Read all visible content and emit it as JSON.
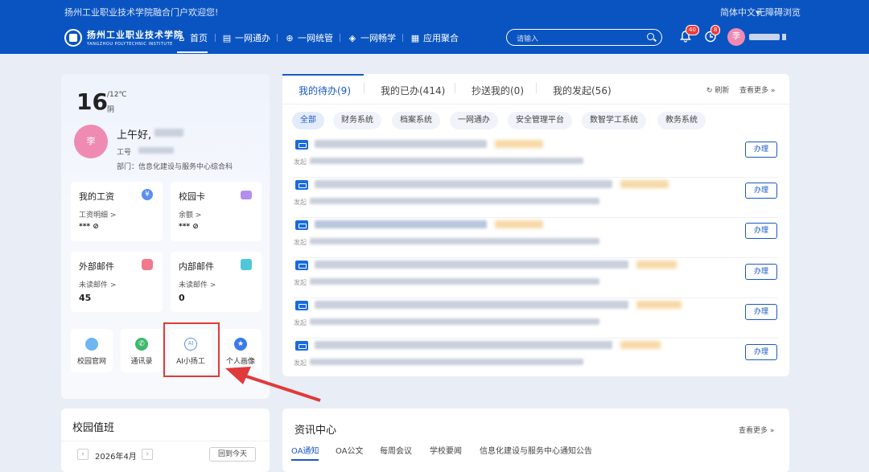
{
  "header": {
    "welcome": "扬州工业职业技术学院融合门户欢迎您!",
    "lang": "简体中文",
    "accessibility": "无障碍浏览",
    "logo_cn": "扬州工业职业技术学院",
    "logo_en": "YANGZHOU POLYTECHNIC INSTITUTE"
  },
  "nav": {
    "items": [
      {
        "label": "首页",
        "icon": "home-icon"
      },
      {
        "label": "一网通办",
        "icon": "briefcase-icon"
      },
      {
        "label": "一网统管",
        "icon": "globe-icon"
      },
      {
        "label": "一网畅学",
        "icon": "graduation-cap-icon"
      },
      {
        "label": "应用聚合",
        "icon": "grid-icon"
      }
    ],
    "search_placeholder": "请输入",
    "notif_count": "40",
    "clock_count": "8",
    "avatar": "李"
  },
  "weather": {
    "temp": "16",
    "range": "/12℃",
    "desc": "阴"
  },
  "user": {
    "avatar": "李",
    "greeting": "上午好,",
    "id_label": "工号",
    "dept": "部门：信息化建设与服务中心综合科"
  },
  "cards": [
    {
      "title": "我的工资",
      "sub": "工资明细 >",
      "value": "*** ⊘",
      "icon": "yuan-icon",
      "color": "#5b8ff0"
    },
    {
      "title": "校园卡",
      "sub": "余额 >",
      "value": "*** ⊘",
      "icon": "card-icon",
      "color": "#b58ef0"
    },
    {
      "title": "外部邮件",
      "sub": "未读邮件 >",
      "value": "45",
      "icon": "mail-icon",
      "color": "#f07a8b"
    },
    {
      "title": "内部邮件",
      "sub": "未读邮件 >",
      "value": "0",
      "icon": "box-icon",
      "color": "#4fc7d8"
    }
  ],
  "tiles": [
    {
      "label": "校园官网",
      "icon": "cloud-icon",
      "color": "#6cb6f2"
    },
    {
      "label": "通讯录",
      "icon": "phone-icon",
      "color": "#3cb96a"
    },
    {
      "label": "AI小扬工",
      "icon": "ai-icon",
      "color": "#5b8ff0"
    },
    {
      "label": "个人画像",
      "icon": "star-badge-icon",
      "color": "#3a7be8"
    }
  ],
  "tasks": {
    "tabs": [
      "我的待办(9)",
      "我的已办(414)",
      "抄送我的(0)",
      "我的发起(56)"
    ],
    "refresh": "刷新",
    "more": "查看更多",
    "filters": [
      "全部",
      "财务系统",
      "档案系统",
      "一网通办",
      "安全管理平台",
      "数智学工系统",
      "教务系统"
    ],
    "row_prefix": "发起",
    "action": "办理"
  },
  "duty": {
    "title": "校园值班",
    "month": "2026年4月",
    "today": "回到今天"
  },
  "news": {
    "title": "资讯中心",
    "more": "查看更多",
    "tabs": [
      "OA通知",
      "OA公文",
      "每周会议",
      "学校要闻",
      "信息化建设与服务中心通知公告"
    ]
  }
}
